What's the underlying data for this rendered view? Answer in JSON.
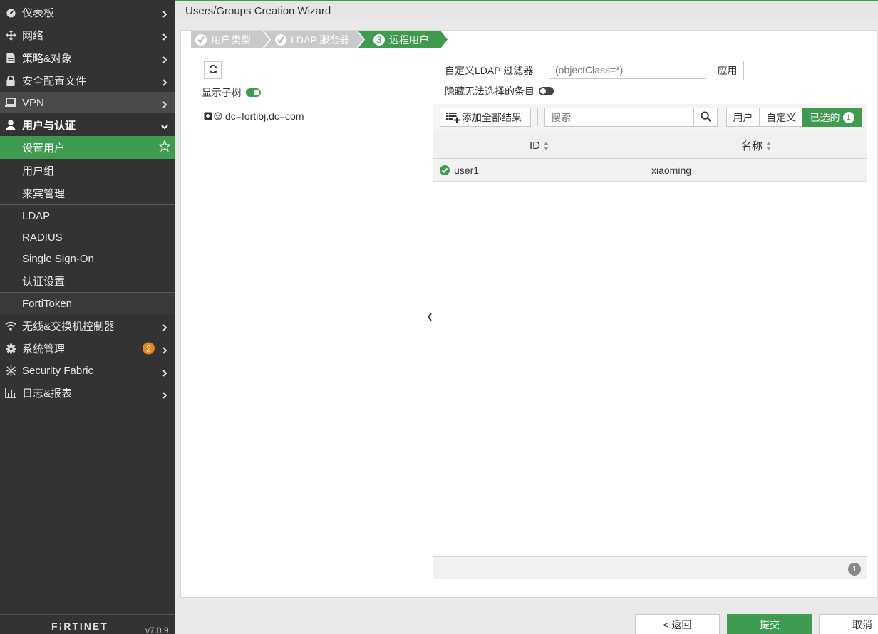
{
  "sidebar": {
    "items": [
      {
        "label": "仪表板",
        "icon": "dashboard-icon"
      },
      {
        "label": "网络",
        "icon": "network-icon"
      },
      {
        "label": "策略&对象",
        "icon": "policy-icon"
      },
      {
        "label": "安全配置文件",
        "icon": "lock-icon"
      },
      {
        "label": "VPN",
        "icon": "laptop-icon"
      },
      {
        "label": "用户与认证",
        "icon": "user-icon"
      },
      {
        "label": "设置用户"
      },
      {
        "label": "用户组"
      },
      {
        "label": "来宾管理"
      },
      {
        "label": "LDAP"
      },
      {
        "label": "RADIUS"
      },
      {
        "label": "Single Sign-On"
      },
      {
        "label": "认证设置"
      },
      {
        "label": "FortiToken"
      },
      {
        "label": "无线&交换机控制器",
        "icon": "wifi-icon"
      },
      {
        "label": "系统管理",
        "icon": "gear-icon",
        "badge": "2"
      },
      {
        "label": "Security Fabric",
        "icon": "fabric-icon"
      },
      {
        "label": "日志&报表",
        "icon": "chart-icon"
      }
    ],
    "brand": "F⁞RTINET",
    "version": "v7.0.9"
  },
  "header": {
    "title": "Users/Groups Creation Wizard"
  },
  "wizard": {
    "steps": [
      {
        "label": "用户类型",
        "state": "done"
      },
      {
        "label": "LDAP 服务器",
        "state": "done"
      },
      {
        "label": "远程用户",
        "number": "3",
        "state": "current"
      }
    ]
  },
  "left_pane": {
    "show_subtree_label": "显示子树",
    "show_subtree_on": true,
    "tree_root": "dc=fortibj,dc=com"
  },
  "right_pane": {
    "filter_label": "自定义LDAP 过滤器",
    "filter_placeholder": "(objectClass=*)",
    "apply_label": "应用",
    "hide_label": "隐藏无法选择的条目",
    "hide_on": false,
    "add_all_label": "添加全部结果",
    "search_placeholder": "搜索",
    "tabs": [
      {
        "label": "用户"
      },
      {
        "label": "自定义"
      },
      {
        "label": "已选的",
        "count": "1",
        "active": true
      }
    ],
    "table": {
      "columns": [
        "ID",
        "名称"
      ],
      "rows": [
        {
          "id": "user1",
          "name": "xiaoming"
        }
      ],
      "footer_count": "1"
    }
  },
  "buttons": {
    "back": "< 返回",
    "submit": "提交",
    "cancel": "取消"
  },
  "colors": {
    "accent": "#3f9b4f",
    "sidebar_bg": "#333333",
    "badge": "#e8891d"
  }
}
